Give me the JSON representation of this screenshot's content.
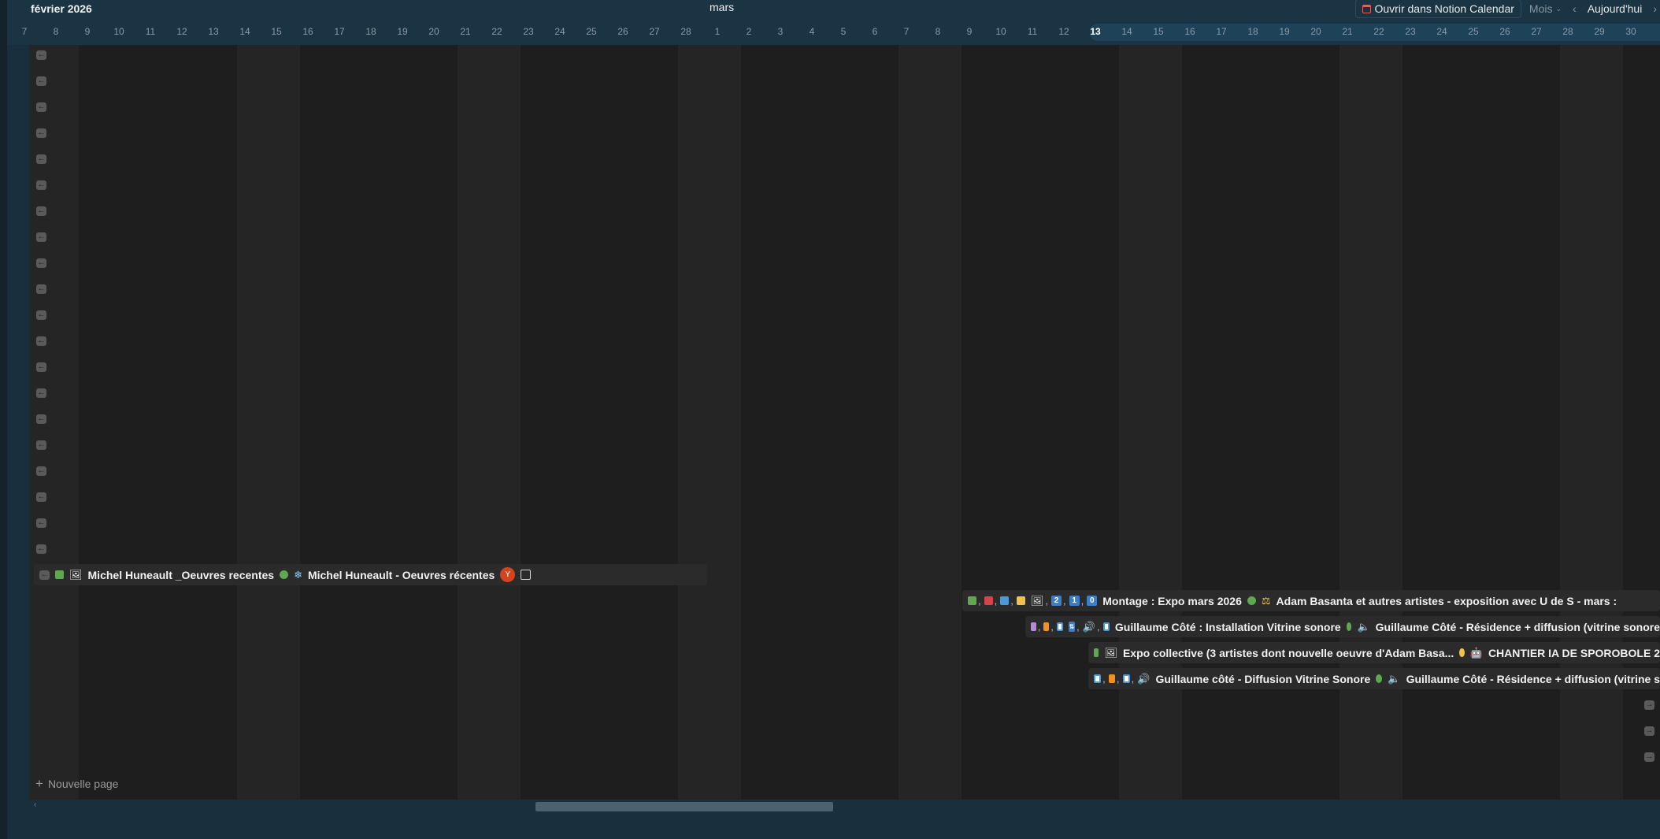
{
  "header": {
    "month_left": "février 2026",
    "month_center": "mars",
    "days": [
      "7",
      "8",
      "9",
      "10",
      "11",
      "12",
      "13",
      "14",
      "15",
      "16",
      "17",
      "18",
      "19",
      "20",
      "21",
      "22",
      "23",
      "24",
      "25",
      "26",
      "27",
      "28",
      "1",
      "2",
      "3",
      "4",
      "5",
      "6",
      "7",
      "8",
      "9",
      "10",
      "11",
      "12",
      "13",
      "14",
      "15",
      "16",
      "17",
      "18",
      "19",
      "20",
      "21",
      "22",
      "23",
      "24",
      "25",
      "26",
      "27",
      "28",
      "29",
      "30"
    ],
    "today_label": "13"
  },
  "toolbar": {
    "open_notion_calendar": "Ouvrir dans Notion Calendar",
    "view": "Mois",
    "today": "Aujourd'hui",
    "prev_icon": "chevron-left-icon",
    "next_icon": "chevron-right-icon"
  },
  "rows": [
    {
      "title": "Michel Huneault _Oeuvres recentes",
      "relation": "Michel Huneault - Oeuvres récentes",
      "avatar": "Y",
      "status_color": "#5fa84f"
    },
    {
      "nums": [
        "2",
        "1",
        "0"
      ],
      "title": "Montage : Expo mars 2026",
      "relation": "Adam Basanta et autres artistes - exposition avec U de S - mars :",
      "status_color": "#5fa84f"
    },
    {
      "title": "Guillaume Côté : Installation Vitrine sonore",
      "relation": "Guillaume Côté - Résidence + diffusion (vitrine sonore",
      "status_color": "#5fa84f"
    },
    {
      "title": "Expo collective (3 artistes dont nouvelle oeuvre d'Adam Basa...",
      "relation": "CHANTIER IA DE SPOROBOLE 2",
      "status_color": "#f0c24a"
    },
    {
      "title": "Guillaume côté - Diffusion Vitrine Sonore",
      "relation": "Guillaume Côté - Résidence + diffusion (vitrine s",
      "status_color": "#5fa84f"
    }
  ],
  "new_page": "Nouvelle page",
  "colors": {
    "green": "#5fa84f",
    "red": "#d9424a",
    "blue": "#4a9ad9",
    "yellow": "#f0c24a",
    "orange": "#f0901e",
    "purple": "#b58ad9"
  }
}
